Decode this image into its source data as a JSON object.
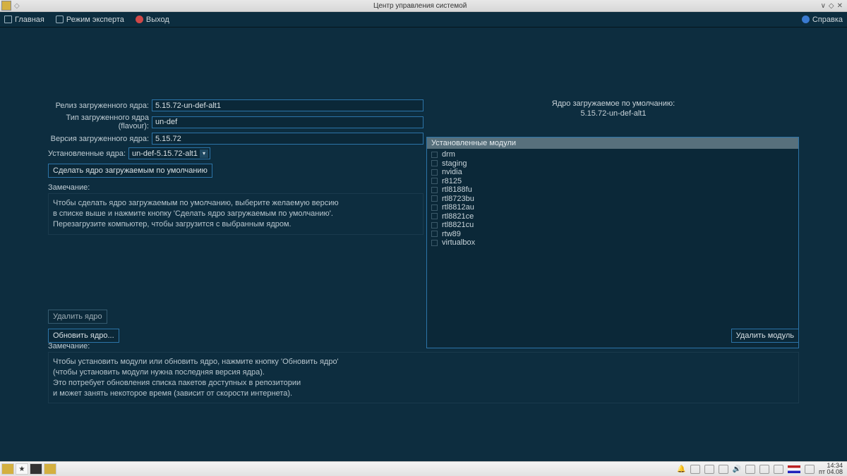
{
  "titlebar": {
    "title": "Центр управления системой"
  },
  "menu": {
    "home": "Главная",
    "expert": "Режим эксперта",
    "exit": "Выход",
    "help": "Справка"
  },
  "kernel": {
    "release_label": "Релиз загруженного ядра:",
    "release_value": "5.15.72-un-def-alt1",
    "flavour_label": "Тип загруженного ядра (flavour):",
    "flavour_value": "un-def",
    "version_label": "Версия загруженного ядра:",
    "version_value": "5.15.72",
    "installed_label": "Установленные ядра:",
    "installed_value": "un-def-5.15.72-alt1",
    "make_default_btn": "Сделать ядро загружаемым по умолчанию",
    "note_label": "Замечание:",
    "note_l1": "Чтобы сделать ядро загружаемым по умолчанию, выберите желаемую версию",
    "note_l2": "в списке выше и нажмите кнопку 'Сделать ядро загружаемым по умолчанию'.",
    "note_l3": "Перезагрузите компьютер, чтобы загрузится с выбранным ядром.",
    "default_title": "Ядро загружаемое по умолчанию:",
    "default_value": "5.15.72-un-def-alt1",
    "delete_kernel_btn": "Удалить ядро",
    "update_kernel_btn": "Обновить ядро...",
    "delete_module_btn": "Удалить модуль",
    "note2_label": "Замечание:",
    "note2_l1": "Чтобы установить модули или обновить ядро, нажмите кнопку 'Обновить ядро'",
    "note2_l2": "(чтобы установить модули нужна последняя версия ядра).",
    "note2_l3": "Это потребует обновления списка пакетов доступных в репозитории",
    "note2_l4": "и может занять некоторое время (зависит от скорости интернета)."
  },
  "modules": {
    "header": "Установленные модули",
    "items": [
      "drm",
      "staging",
      "nvidia",
      "r8125",
      "rtl8188fu",
      "rtl8723bu",
      "rtl8812au",
      "rtl8821ce",
      "rtl8821cu",
      "rtw89",
      "virtualbox"
    ]
  },
  "taskbar": {
    "time": "14:34",
    "date": "пт 04.08"
  }
}
